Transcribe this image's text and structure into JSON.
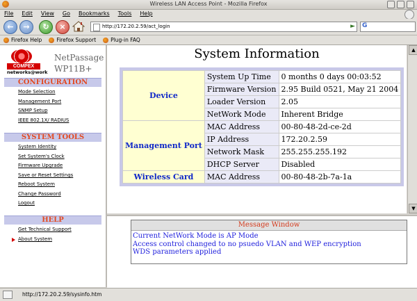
{
  "window": {
    "title": "Wireless LAN Access Point - Mozilla Firefox"
  },
  "menubar": {
    "items": [
      "File",
      "Edit",
      "View",
      "Go",
      "Bookmarks",
      "Tools",
      "Help"
    ]
  },
  "navbar": {
    "url": "http://172.20.2.59/act_login",
    "search_placeholder": "",
    "icons": [
      "back-arrow-icon",
      "forward-arrow-icon",
      "reload-icon",
      "stop-icon",
      "home-icon",
      "go-icon",
      "google-search-icon"
    ]
  },
  "bookmarks": [
    "Firefox Help",
    "Firefox Support",
    "Plug-in FAQ"
  ],
  "sidebar": {
    "brand": "COMPEX",
    "tagline": "networks@work",
    "product": [
      "NetPassage",
      "WP11B+"
    ],
    "sections": [
      {
        "title": "CONFIGURATION",
        "links": [
          "Mode Selection",
          "Management Port",
          "SNMP Setup",
          "IEEE 802.1X/ RADIUS"
        ]
      },
      {
        "title": "SYSTEM TOOLS",
        "links": [
          "System Identity",
          "Set System's Clock",
          "Firmware Upgrade",
          "Save or Reset Settings",
          "Reboot System",
          "Change Password",
          "Logout"
        ]
      },
      {
        "title": "HELP",
        "links": [
          "Get Technical Support",
          "About System"
        ]
      }
    ],
    "active_link": "About System"
  },
  "main": {
    "title": "System Information",
    "groups": {
      "device": "Device",
      "management": "Management Port",
      "wireless": "Wireless Card"
    },
    "rows": [
      {
        "label": "System Up Time",
        "value": "0 months 0 days 00:03:52"
      },
      {
        "label": "Firmware Version",
        "value": "2.95 Build 0521, May 21 2004"
      },
      {
        "label": "Loader Version",
        "value": "2.05"
      },
      {
        "label": "NetWork Mode",
        "value": "Inherent Bridge"
      },
      {
        "label": "MAC Address",
        "value": "00-80-48-2d-ce-2d"
      },
      {
        "label": "IP Address",
        "value": "172.20.2.59"
      },
      {
        "label": "Network Mask",
        "value": "255.255.255.192"
      },
      {
        "label": "DHCP Server",
        "value": "Disabled"
      },
      {
        "label": "MAC Address",
        "value": "00-80-48-2b-7a-1a"
      }
    ]
  },
  "message_window": {
    "title": "Message Window",
    "lines": [
      "Current NetWork Mode is AP Mode",
      "Access control changed to no psuedo VLAN and WEP encryption",
      "WDS parameters applied"
    ]
  },
  "status": {
    "text": "http://172.20.2.59/sysinfo.htm"
  },
  "colors": {
    "section_bg": "#c7c9ea",
    "section_text": "#e24a22",
    "group_bg": "#ffffd2",
    "group_text": "#1028c8",
    "message_text": "#1d1ddc"
  }
}
